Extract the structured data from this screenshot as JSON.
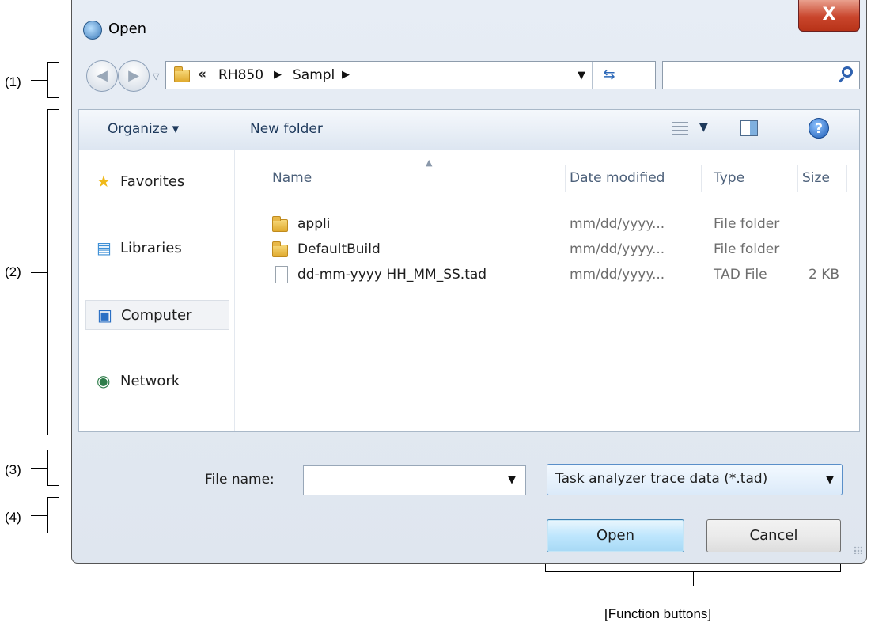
{
  "annotations": {
    "nav_area": "(1)",
    "list_area": "(2)",
    "filename_area": "(3)",
    "buttons_area": "(4)",
    "function_buttons": "[Function buttons]"
  },
  "window": {
    "title": "Open",
    "close_label": "X"
  },
  "nav": {
    "address_overflow": "«",
    "crumbs": [
      "RH850",
      "Sampl"
    ],
    "search_placeholder": ""
  },
  "toolbar": {
    "organize_label": "Organize ▾",
    "new_folder_label": "New folder"
  },
  "sidebar": {
    "items": [
      {
        "label": "Favorites",
        "icon": "star-icon"
      },
      {
        "label": "Libraries",
        "icon": "libraries-icon"
      },
      {
        "label": "Computer",
        "icon": "computer-icon",
        "selected": true
      },
      {
        "label": "Network",
        "icon": "network-icon"
      }
    ]
  },
  "files": {
    "columns": [
      "Name",
      "Date modified",
      "Type",
      "Size"
    ],
    "rows": [
      {
        "name": "appli",
        "date": "mm/dd/yyyy...",
        "type": "File folder",
        "size": "",
        "icon": "folder-icon"
      },
      {
        "name": "DefaultBuild",
        "date": "mm/dd/yyyy...",
        "type": "File folder",
        "size": "",
        "icon": "folder-icon"
      },
      {
        "name": "dd-mm-yyyy HH_MM_SS.tad",
        "date": "mm/dd/yyyy...",
        "type": "TAD File",
        "size": "2 KB",
        "icon": "file-icon"
      }
    ]
  },
  "form": {
    "file_name_label": "File name:",
    "file_name_value": "",
    "file_type_value": "Task analyzer trace data (*.tad)",
    "open_label": "Open",
    "cancel_label": "Cancel"
  },
  "colors": {
    "chrome_bg": "#dfe6ef",
    "toolbar_text": "#1e395b",
    "close_red": "#c9452c",
    "open_button": "#bee6fd"
  }
}
